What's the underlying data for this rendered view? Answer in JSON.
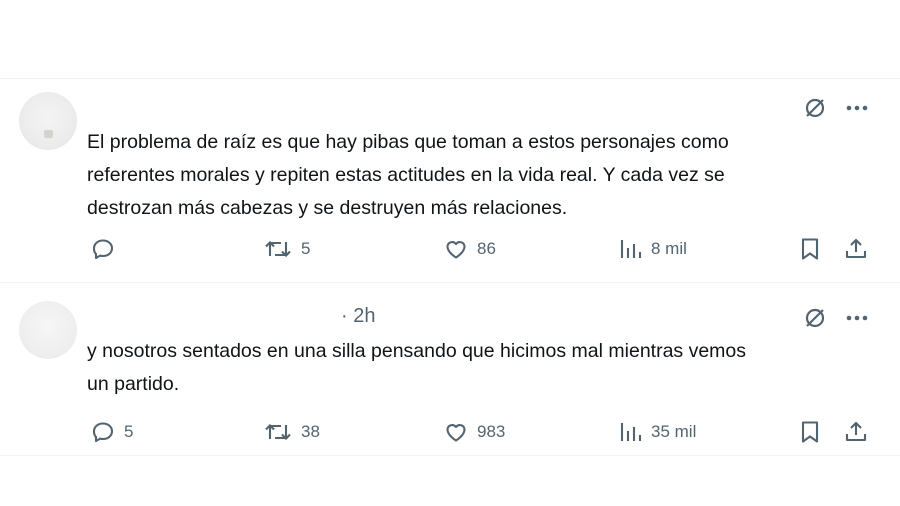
{
  "posts": [
    {
      "time": "",
      "text_lines": [
        "El problema de raíz es que hay pibas que toman a estos personajes como",
        "referentes morales y repiten estas actitudes en la vida real. Y cada vez se",
        "destrozan más cabezas y se destruyen más relaciones."
      ],
      "actions": {
        "replies": "",
        "reposts": "5",
        "likes": "86",
        "views": "8 mil"
      }
    },
    {
      "time": "· 2h",
      "text_lines": [
        "y nosotros sentados en una silla pensando que hicimos mal mientras vemos",
        "un partido."
      ],
      "actions": {
        "replies": "5",
        "reposts": "38",
        "likes": "983",
        "views": "35 mil"
      }
    }
  ],
  "icons": {
    "top": [
      "grok-icon",
      "more-icon"
    ],
    "actions": [
      "reply-icon",
      "repost-icon",
      "like-icon",
      "views-icon",
      "bookmark-icon",
      "share-icon"
    ]
  },
  "colors": {
    "text": "#0f1419",
    "muted": "#536471",
    "divider": "#eff3f4"
  }
}
